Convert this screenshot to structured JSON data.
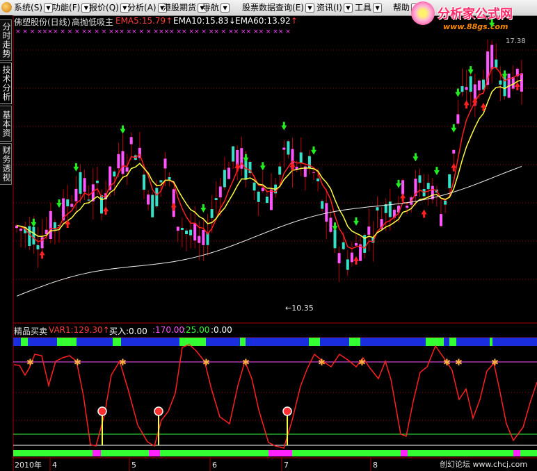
{
  "menubar": {
    "items": [
      {
        "name": "menu-system",
        "label": "系统",
        "key": "S",
        "x": 20
      },
      {
        "name": "menu-function",
        "label": "功能",
        "key": "F",
        "x": 75
      },
      {
        "name": "menu-quote",
        "label": "报价",
        "key": "Q",
        "x": 128
      },
      {
        "name": "menu-analysis",
        "label": "分析",
        "key": "A",
        "x": 183
      },
      {
        "name": "menu-hk-futures",
        "label": "港股期货",
        "key": "",
        "x": 234
      },
      {
        "name": "menu-navigate",
        "label": "导航",
        "key": "",
        "x": 291
      },
      {
        "name": "menu-stock-data",
        "label": "股票数据查询",
        "key": "E",
        "x": 348
      },
      {
        "name": "menu-info",
        "label": "资讯",
        "key": "I",
        "x": 455
      },
      {
        "name": "menu-tools",
        "label": "工具",
        "key": "",
        "x": 510
      },
      {
        "name": "menu-help",
        "label": "帮助",
        "key": "",
        "x": 565
      }
    ]
  },
  "brand": {
    "name": "分析家公式网",
    "url": "www.88gs.com"
  },
  "sidetabs": [
    {
      "label": "分时走势",
      "active": false
    },
    {
      "label": "技术分析",
      "active": true
    },
    {
      "label": "基本资料",
      "active": false
    },
    {
      "label": "财务透视",
      "active": false
    }
  ],
  "main_header": {
    "stock": "佛塑股份(日线)",
    "formula": "高抛低吸主",
    "ema5": "EMA5:15.79",
    "ema10": "EMA10:15.83",
    "ema60": "EMA60:13.92",
    "colors": {
      "stock": "#e0e0e0",
      "ema5": "#ff3c3c",
      "ema10": "#ffffff",
      "ema60": "#ffffff"
    }
  },
  "price_labels": {
    "high": "17.38",
    "low": "←10.35"
  },
  "sub_header": {
    "name": "精品买卖",
    "var1": "VAR1:129.30",
    "buy": "买入:0.00",
    "v170": ":170.00",
    "v25": ":25.00",
    "v0": ":0.00",
    "colors": {
      "name": "#e0e0e0",
      "var1": "#ff3c3c",
      "buy": "#ffffff",
      "v170": "#ff55ff",
      "v25": "#33ff33",
      "v0": "#ffffff"
    }
  },
  "time_axis": {
    "year": "2010年",
    "months": [
      "4",
      "5",
      "6",
      "7",
      "8"
    ]
  },
  "watermark": "创幻论坛 www.chcj.com",
  "colors": {
    "up_candle": "#ff55ff",
    "down_candle": "#33e0c8",
    "ema5": "#ff2020",
    "ema10": "#ffff40",
    "ema60": "#f0f0f0",
    "buy_arrow": "#ff2020",
    "sell_arrow": "#22ee22",
    "grid": "#8a0000"
  },
  "chart_data": {
    "type": "candlestick",
    "title": "佛塑股份(日线) 高抛低吸主",
    "series": [
      {
        "name": "EMA5",
        "last": 15.79
      },
      {
        "name": "EMA10",
        "last": 15.83
      },
      {
        "name": "EMA60",
        "last": 13.92
      }
    ],
    "price_high": 17.38,
    "price_low": 10.35,
    "x_categories": [
      "2010年",
      "4",
      "5",
      "6",
      "7",
      "8"
    ],
    "oscillator": {
      "name": "精品买卖",
      "VAR1": 129.3,
      "买入": 0.0,
      "levels": [
        170.0,
        25.0,
        0.0
      ]
    }
  }
}
